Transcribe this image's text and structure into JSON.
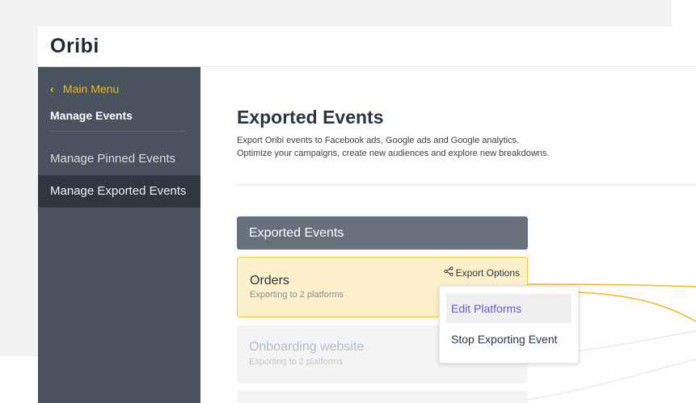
{
  "app": {
    "brand": "Oribi"
  },
  "sidebar": {
    "back_label": "Main Menu",
    "title": "Manage Events",
    "items": [
      {
        "label": "Manage Pinned Events",
        "active": false
      },
      {
        "label": "Manage Exported Events",
        "active": true
      }
    ]
  },
  "main": {
    "title": "Exported Events",
    "description_line1": "Export Oribi events to Facebook ads, Google ads and Google analytics.",
    "description_line2": "Optimize your campaigns, create new audiences and explore new breakdowns.",
    "list_header": "Exported Events",
    "events": [
      {
        "name": "Orders",
        "status": "Exporting to 2 platforms",
        "selected": true
      },
      {
        "name": "Onboarding website",
        "status": "Exporting to 2 platforms",
        "selected": false
      }
    ],
    "export_options_label": "Export Options"
  },
  "dropdown": {
    "items": [
      {
        "label": "Edit Platforms",
        "highlighted": true
      },
      {
        "label": "Stop Exporting Event",
        "highlighted": false
      }
    ]
  },
  "colors": {
    "sidebar_bg": "#48535d",
    "sidebar_active_bg": "#2f373f",
    "accent_yellow": "#f2b51c",
    "selected_card_bg": "#fdf1cc",
    "selected_card_border": "#f5c542",
    "menu_highlight_text": "#6a5acd",
    "connector_line": "#f5b820"
  },
  "icons": {
    "back": "chevron-left-icon",
    "export": "share-nodes-icon"
  }
}
